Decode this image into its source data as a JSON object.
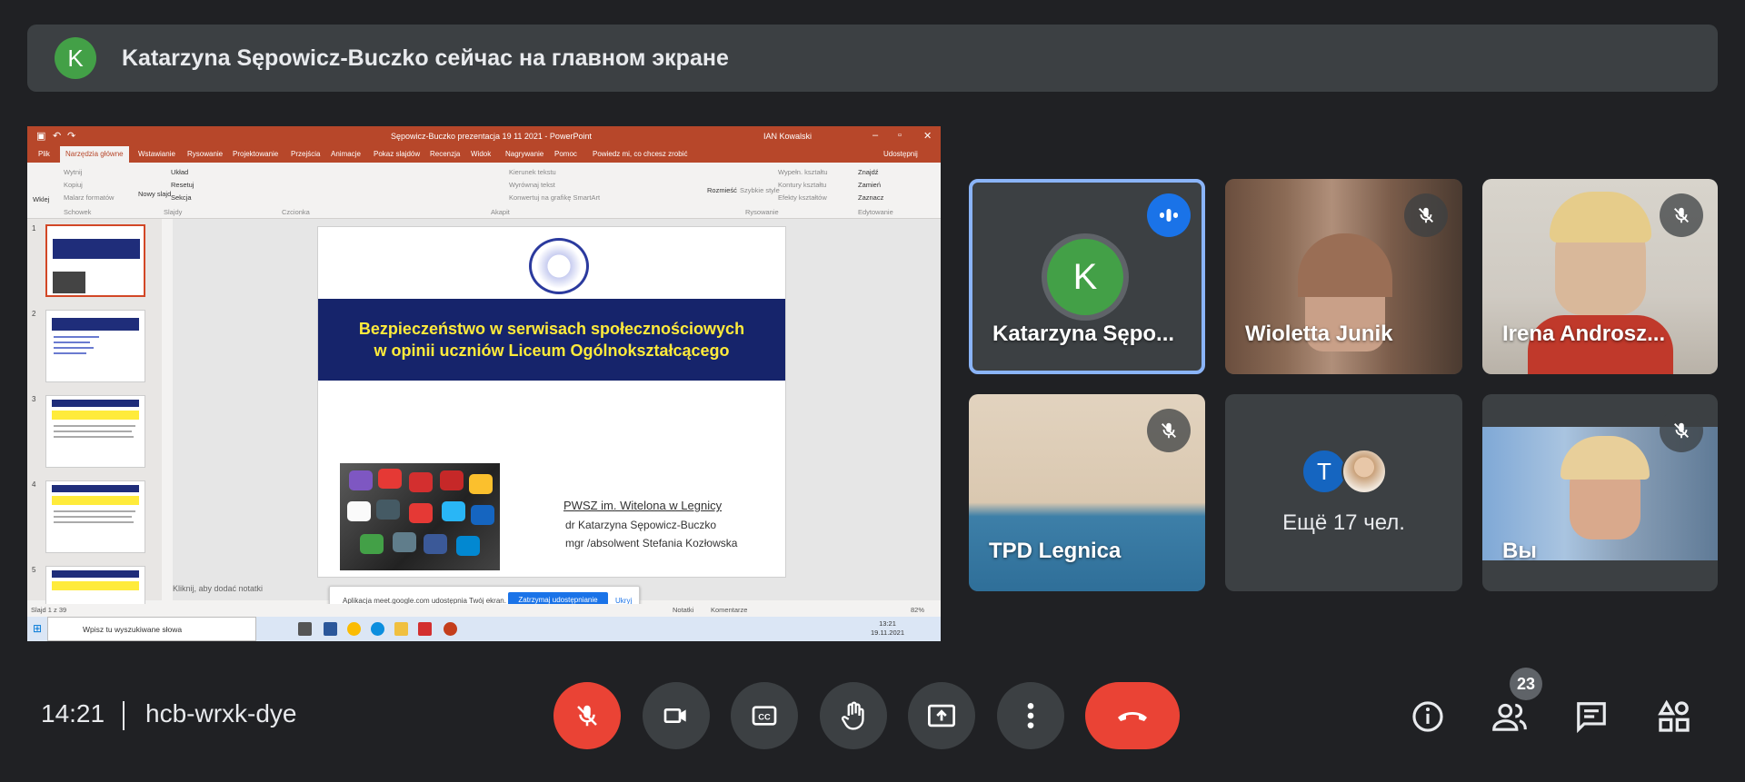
{
  "banner": {
    "avatar_letter": "K",
    "text": "Katarzyna Sępowicz-Buczko сейчас на главном экране"
  },
  "presentation": {
    "window_title": "Sępowicz-Buczko prezentacja 19 11 2021  -  PowerPoint",
    "user": "IAN Kowalski",
    "menu": [
      "Plik",
      "Narzędzia główne",
      "Wstawianie",
      "Rysowanie",
      "Projektowanie",
      "Przejścia",
      "Animacje",
      "Pokaz slajdów",
      "Recenzja",
      "Widok",
      "Nagrywanie",
      "Pomoc",
      "Powiedz mi, co chcesz zrobić",
      "Udostępnij"
    ],
    "ribbon_groups": [
      "Schowek",
      "Slajdy",
      "Czcionka",
      "Akapit",
      "Rysowanie",
      "Edytowanie"
    ],
    "ribbon_items": [
      "Wklej",
      "Wytnij",
      "Kopiuj",
      "Malarz formatów",
      "Nowy slajd",
      "Układ",
      "Resetuj",
      "Sekcja",
      "Kierunek tekstu",
      "Wyrównaj tekst",
      "Konwertuj na grafikę SmartArt",
      "Rozmieść",
      "Szybkie style",
      "Wypełn. kształtu",
      "Kontury kształtu",
      "Efekty kształtów",
      "Znajdź",
      "Zamień",
      "Zaznacz"
    ],
    "slide_numbers": [
      "1",
      "2",
      "3",
      "4",
      "5"
    ],
    "slide": {
      "title_line1": "Bezpieczeństwo w serwisach społecznościowych",
      "title_line2": "w opinii uczniów Liceum Ogólnokształcącego",
      "institution": "PWSZ im. Witelona w Legnicy",
      "author1": "dr Katarzyna Sępowicz-Buczko",
      "author2": "mgr /absolwent Stefania Kozłowska"
    },
    "notes_placeholder": "Kliknij, aby dodać notatki",
    "share_message": "Aplikacja meet.google.com udostępnia Twój ekran.",
    "share_stop": "Zatrzymaj udostępnianie",
    "share_hide": "Ukryj",
    "status_slide": "Slajd 1 z 39",
    "status_notes": "Notatki",
    "status_comments": "Komentarze",
    "status_zoom": "82%",
    "taskbar_search": "Wpisz tu wyszukiwane słowa",
    "tray_time": "13:21",
    "tray_date": "19.11.2021"
  },
  "tiles": [
    {
      "name": "Katarzyna Sępo...",
      "avatar_letter": "K",
      "icon": "speaking-icon"
    },
    {
      "name": "Wioletta Junik",
      "icon": "mic-off-icon"
    },
    {
      "name": "Irena Androsz...",
      "icon": "mic-off-icon"
    },
    {
      "name": "TPD Legnica",
      "icon": "mic-off-icon"
    },
    {
      "name": "Ещё 17 чел.",
      "avatar_letter": "T"
    },
    {
      "name": "Вы",
      "icon": "mic-off-icon"
    }
  ],
  "bottom": {
    "time": "14:21",
    "meeting_code": "hcb-wrxk-dye",
    "participants_count": "23"
  },
  "colors": {
    "accent_red": "#ea4335",
    "speaking_blue": "#1a73e8",
    "avatar_green": "#43a047",
    "ppt_orange": "#b7472a"
  }
}
